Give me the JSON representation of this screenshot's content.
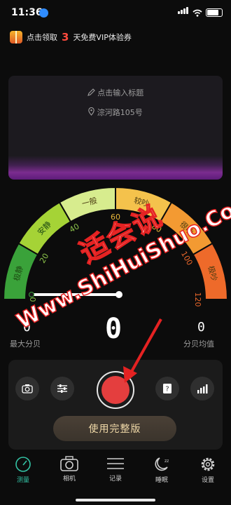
{
  "status": {
    "time": "11:36"
  },
  "promo": {
    "prefix": "点击领取",
    "number": "3",
    "suffix": "天免费VIP体验券"
  },
  "card": {
    "title_hint": "点击输入标题",
    "location": "淙河路105号"
  },
  "gauge": {
    "zones": [
      {
        "label": "极静",
        "color": "#3aa23a"
      },
      {
        "label": "安静",
        "color": "#a5d336"
      },
      {
        "label": "一般",
        "color": "#d7ec8e"
      },
      {
        "label": "较吵",
        "color": "#f4c24c"
      },
      {
        "label": "很吵",
        "color": "#f39a32"
      },
      {
        "label": "极吵",
        "color": "#ee6a2a"
      }
    ],
    "ticks": [
      "0",
      "20",
      "40",
      "60",
      "80",
      "100",
      "120"
    ],
    "value": 0
  },
  "readings": {
    "max_value": "0",
    "max_label": "最大分贝",
    "current_value": "0",
    "avg_value": "0",
    "avg_label": "分贝均值"
  },
  "controls": {
    "full_version_label": "使用完整版"
  },
  "tabs": [
    {
      "label": "测量",
      "icon": "gauge-icon",
      "active": true
    },
    {
      "label": "相机",
      "icon": "camera-icon",
      "active": false
    },
    {
      "label": "记录",
      "icon": "list-icon",
      "active": false
    },
    {
      "label": "睡眠",
      "icon": "moon-icon",
      "active": false
    },
    {
      "label": "设置",
      "icon": "gear-icon",
      "active": false
    }
  ],
  "watermark": {
    "cn": "适会说",
    "en": "Www.ShiHuiShuo.Com"
  },
  "accent": "#33c2a4",
  "record_color": "#e43e3e"
}
